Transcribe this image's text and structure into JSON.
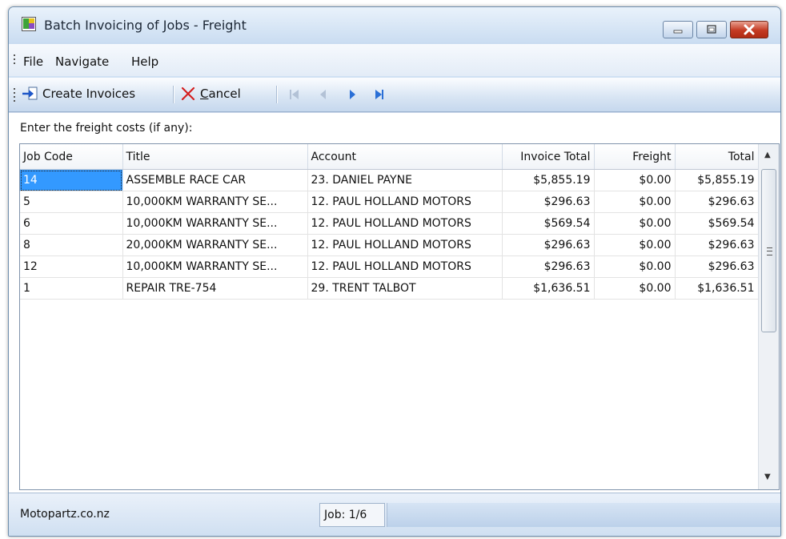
{
  "window": {
    "title": "Batch Invoicing of Jobs - Freight"
  },
  "menu": {
    "items": [
      "File",
      "Navigate",
      "Help"
    ]
  },
  "toolbar": {
    "create_label": "Create Invoices",
    "cancel_label": "Cancel",
    "cancel_accel": "C",
    "cancel_rest": "ancel"
  },
  "content": {
    "prompt": "Enter the freight costs (if any):"
  },
  "table": {
    "columns": [
      "Job Code",
      "Title",
      "Account",
      "Invoice Total",
      "Freight",
      "Total"
    ],
    "rows": [
      [
        "14",
        "ASSEMBLE RACE CAR",
        "23. DANIEL PAYNE",
        "$5,855.19",
        "$0.00",
        "$5,855.19"
      ],
      [
        "5",
        "10,000KM WARRANTY SE...",
        "12. PAUL HOLLAND MOTORS",
        "$296.63",
        "$0.00",
        "$296.63"
      ],
      [
        "6",
        "10,000KM WARRANTY SE...",
        "12. PAUL HOLLAND MOTORS",
        "$569.54",
        "$0.00",
        "$569.54"
      ],
      [
        "8",
        "20,000KM WARRANTY SE...",
        "12. PAUL HOLLAND MOTORS",
        "$296.63",
        "$0.00",
        "$296.63"
      ],
      [
        "12",
        "10,000KM WARRANTY SE...",
        "12. PAUL HOLLAND MOTORS",
        "$296.63",
        "$0.00",
        "$296.63"
      ],
      [
        "1",
        "REPAIR TRE-754",
        "29. TRENT TALBOT",
        "$1,636.51",
        "$0.00",
        "$1,636.51"
      ]
    ]
  },
  "status": {
    "left": "Motopartz.co.nz",
    "job": "Job: 1/6"
  },
  "colors": {
    "selection": "#3399ff",
    "close_button": "#c43a22",
    "chrome": "#cfe0f3"
  },
  "icons": [
    "app-icon",
    "minimize-icon",
    "maximize-icon",
    "close-icon",
    "create-invoices-icon",
    "cancel-icon",
    "first-record-icon",
    "previous-record-icon",
    "next-record-icon",
    "last-record-icon"
  ]
}
